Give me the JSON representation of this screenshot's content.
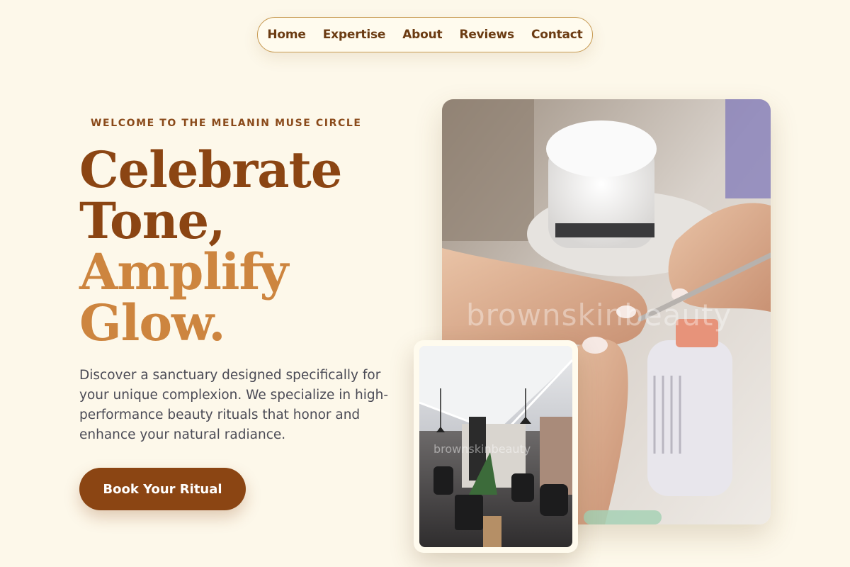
{
  "nav": {
    "items": [
      "Home",
      "Expertise",
      "About",
      "Reviews",
      "Contact"
    ]
  },
  "hero": {
    "eyebrow": "WELCOME TO THE MELANIN MUSE CIRCLE",
    "headline_line1": "Celebrate",
    "headline_line2": "Tone,",
    "headline_line3": "Amplify",
    "headline_line4": "Glow.",
    "description": "Discover a sanctuary designed specifically for your unique complexion. We specialize in high-performance beauty rituals that honor and enhance your natural radiance.",
    "cta_label": "Book Your Ritual"
  },
  "images": {
    "main_watermark": "brownskinbeauty",
    "inset_watermark": "brownskinbeauty"
  },
  "colors": {
    "background": "#fdf8ea",
    "brand_dark": "#8b4513",
    "brand_light": "#cd853f",
    "text": "#4a4a55"
  }
}
